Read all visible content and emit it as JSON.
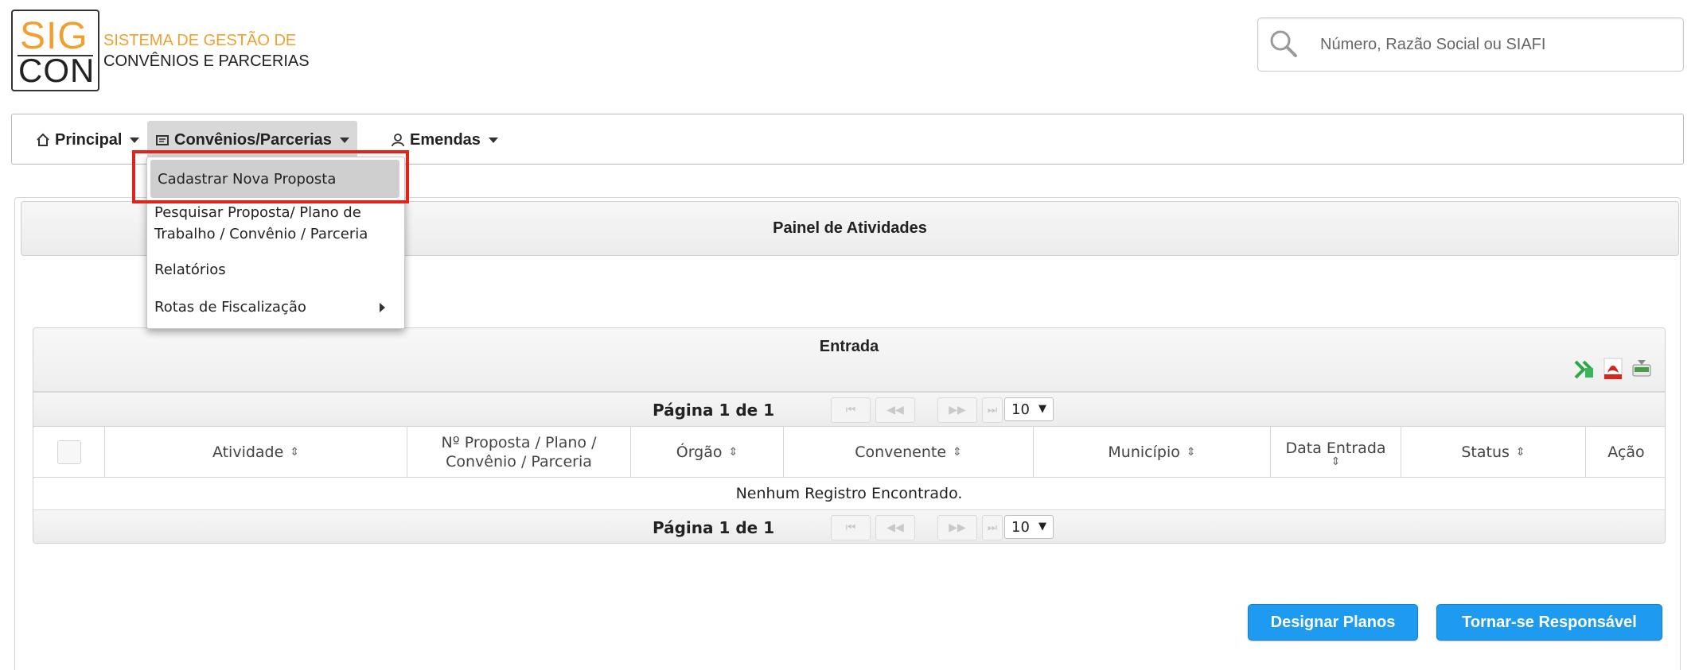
{
  "logo": {
    "sig": "SIG",
    "con": "CON",
    "line1": "SISTEMA DE GESTÃO DE",
    "line2": "CONVÊNIOS E PARCERIAS",
    "colors": {
      "accent": "#f0a030",
      "text": "#222222"
    }
  },
  "search": {
    "placeholder": "Número, Razão Social ou SIAFI",
    "icon": "search-icon"
  },
  "menubar": {
    "items": [
      {
        "label": "Principal",
        "icon": "home-icon"
      },
      {
        "label": "Convênios/Parcerias",
        "icon": "document-icon",
        "active": true
      },
      {
        "label": "Emendas",
        "icon": "user-icon"
      }
    ]
  },
  "dropdown": {
    "items": [
      {
        "label": "Cadastrar Nova Proposta",
        "highlighted": true
      },
      {
        "label_line1": "Pesquisar Proposta/ Plano de",
        "label_line2": "Trabalho / Convênio / Parceria"
      },
      {
        "label": "Relatórios"
      },
      {
        "label": "Rotas de Fiscalização",
        "submenu": true
      }
    ]
  },
  "panel": {
    "title": "Painel de Atividades"
  },
  "entrada": {
    "title": "Entrada",
    "export_icons": [
      "excel-icon",
      "pdf-icon",
      "csv-icon"
    ],
    "pagination": {
      "text": "Página 1 de 1",
      "first": "⏮",
      "prev": "◀◀",
      "next": "▶▶",
      "last": "⏭",
      "page_size": "10"
    },
    "columns": {
      "atividade": "Atividade",
      "proposta_line1": "Nº Proposta / Plano /",
      "proposta_line2": "Convênio / Parceria",
      "orgao": "Órgão",
      "convenente": "Convenente",
      "municipio": "Município",
      "data_entrada": "Data Entrada",
      "status": "Status",
      "acao": "Ação"
    },
    "empty_message": "Nenhum Registro Encontrado."
  },
  "actions": {
    "designar": "Designar Planos",
    "responsavel": "Tornar-se Responsável",
    "button_color": "#1e9bf0"
  },
  "annotation": {
    "highlight_color": "#e2231a"
  }
}
